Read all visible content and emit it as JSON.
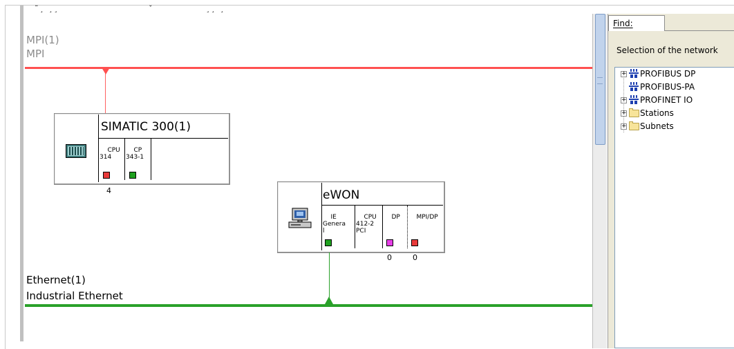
{
  "canvas": {
    "top_fragments": [
      "˜¸ ¸¸",
      "ˇ",
      "¸¸ ¸"
    ],
    "mpi_subnet": {
      "name": "MPI(1)",
      "type": "MPI",
      "color": "#ff5050"
    },
    "ethernet_subnet": {
      "name": "Ethernet(1)",
      "type": "Industrial Ethernet",
      "color": "#2aa12a"
    },
    "stations": [
      {
        "title": "SIMATIC 300(1)",
        "icon": "plc-rack-icon",
        "slots": [
          {
            "label": "CPU\n314",
            "led_color": "#e83a3a"
          },
          {
            "label": "CP\n343-1",
            "led_color": "#1fa01f"
          }
        ],
        "addresses": [
          "4"
        ]
      },
      {
        "title": "eWON",
        "icon": "pc-station-icon",
        "slots": [
          {
            "label": "IE\nGenera\nl",
            "led_color": "#1fa01f"
          },
          {
            "label": "CPU\n412-2\nPCI",
            "led_color": ""
          },
          {
            "label": "DP",
            "led_color": "#e63ee6"
          },
          {
            "label": "MPI/DP",
            "led_color": "#e83a3a"
          }
        ],
        "addresses": [
          "0",
          "0"
        ]
      }
    ]
  },
  "panel": {
    "tab_label": "Find:",
    "selection_label": "Selection of the network",
    "tree": [
      {
        "label": "PROFIBUS DP",
        "expandable": true,
        "icon": "network-icon"
      },
      {
        "label": "PROFIBUS-PA",
        "expandable": false,
        "icon": "network-icon"
      },
      {
        "label": "PROFINET IO",
        "expandable": true,
        "icon": "network-icon"
      },
      {
        "label": "Stations",
        "expandable": true,
        "icon": "folder-icon"
      },
      {
        "label": "Subnets",
        "expandable": true,
        "icon": "folder-icon"
      }
    ]
  }
}
